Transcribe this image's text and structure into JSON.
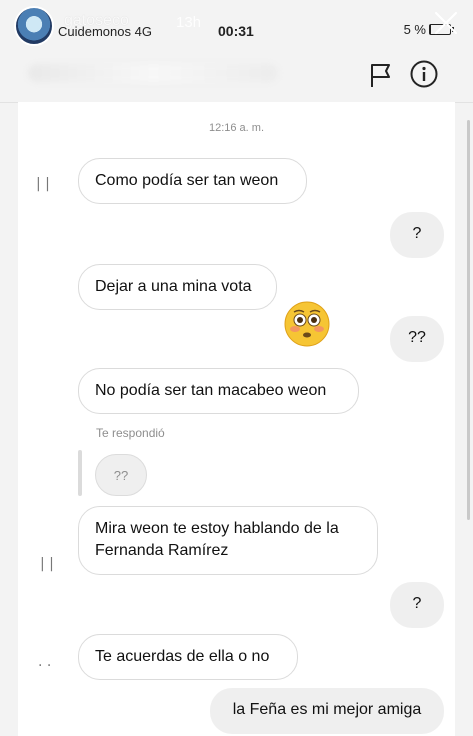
{
  "story": {
    "username": "gatoseco",
    "age": "13h"
  },
  "status_bar": {
    "carrier": "Cuidemonos  4G",
    "time": "00:31",
    "battery": "5 %",
    "battery_level": 0.05
  },
  "chat": {
    "timestamp": "12:16 a. m.",
    "reply_label": "Te respondió",
    "reply_preview": "??",
    "messages": [
      {
        "from": "them",
        "text": "Como podía ser tan weon"
      },
      {
        "from": "me",
        "text": "?"
      },
      {
        "from": "them",
        "text": "Dejar a una mina vota"
      },
      {
        "from": "me",
        "text": "??"
      },
      {
        "from": "them",
        "text": "No podía ser tan macabeo weon"
      },
      {
        "from": "them",
        "text_line1": "Mira weon te estoy hablando de la",
        "text_line2": "Fernanda Ramírez"
      },
      {
        "from": "me",
        "text": "?"
      },
      {
        "from": "them",
        "text": "Te acuerdas de ella o no"
      },
      {
        "from": "me",
        "text": "la Feña es mi mejor amiga"
      }
    ]
  },
  "icons": [
    "close-icon",
    "flag-icon",
    "info-icon",
    "flushed-face-emoji"
  ]
}
